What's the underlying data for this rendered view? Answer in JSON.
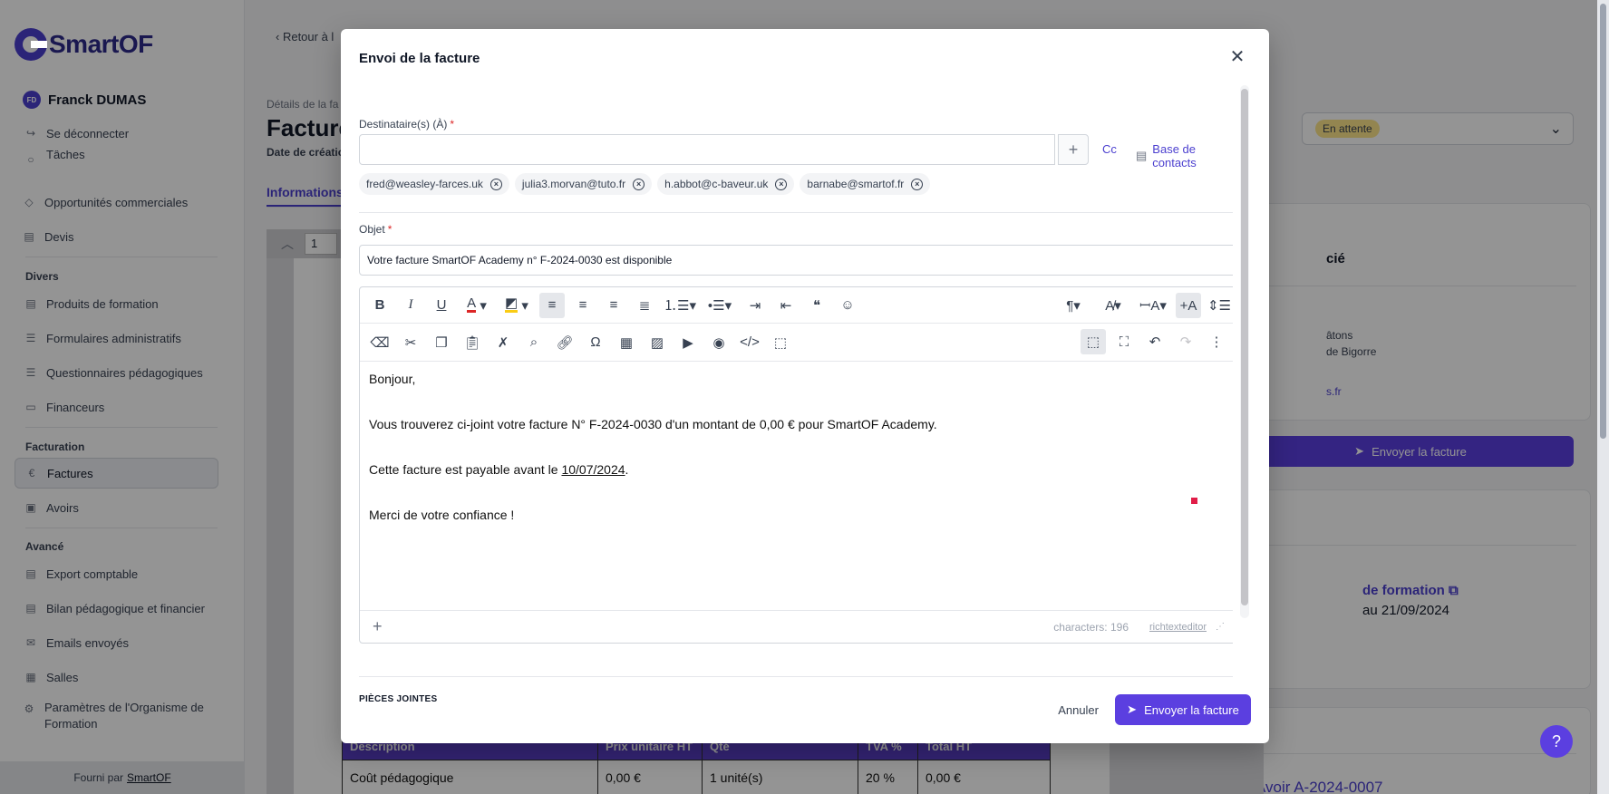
{
  "app": {
    "logo_text": "SmartOF",
    "user_initials": "FD",
    "user_name": "Franck DUMAS",
    "logout": "Se déconnecter",
    "footer_prefix": "Fourni par",
    "footer_link": "SmartOF"
  },
  "sidebar": {
    "items_top": [
      {
        "label": "Tâches"
      },
      {
        "label": "Opportunités commerciales"
      },
      {
        "label": "Devis"
      }
    ],
    "section_divers": "Divers",
    "items_divers": [
      {
        "label": "Produits de formation"
      },
      {
        "label": "Formulaires administratifs"
      },
      {
        "label": "Questionnaires pédagogiques"
      },
      {
        "label": "Financeurs"
      }
    ],
    "section_facturation": "Facturation",
    "items_facturation": [
      {
        "label": "Factures"
      },
      {
        "label": "Avoirs"
      }
    ],
    "section_avance": "Avancé",
    "items_avance": [
      {
        "label": "Export comptable"
      },
      {
        "label": "Bilan pédagogique et financier"
      },
      {
        "label": "Emails envoyés"
      },
      {
        "label": "Salles"
      },
      {
        "label": "Paramètres de l'Organisme de Formation"
      }
    ]
  },
  "page": {
    "back": "Retour à l",
    "breadcrumb": "Détails de la fa",
    "title": "Facture",
    "created": "Date de créatio",
    "tab_info": "Informations",
    "status": "En attente",
    "right_send": "Envoyer la facture",
    "right_text_1": "cié",
    "right_text_2": "âtons",
    "right_text_3": "de Bigorre",
    "right_text_4": "s.fr",
    "right_link_product": "de formation",
    "right_dates": "au 21/09/2024",
    "right_avoir": "Avoir A-2024-0007",
    "pdf_page_input": "1",
    "invoice_table": {
      "headers": [
        "Description",
        "Prix unitaire HT",
        "Qté",
        "TVA %",
        "Total HT"
      ],
      "row": [
        "Coût pédagogique",
        "0,00 €",
        "1 unité(s)",
        "20 %",
        "0,00 €"
      ]
    }
  },
  "modal": {
    "title": "Envoi de la facture",
    "to_label": "Destinataire(s) (À)",
    "to_value": "",
    "cc": "Cc",
    "contacts": "Base de contacts",
    "recipients": [
      "fred@weasley-farces.uk",
      "julia3.morvan@tuto.fr",
      "h.abbot@c-baveur.uk",
      "barnabe@smartof.fr"
    ],
    "subject_label": "Objet",
    "subject_value": "Votre facture SmartOF Academy n° F-2024-0030 est disponible",
    "body": {
      "greeting": "Bonjour,",
      "line1": "Vous trouverez ci-joint votre facture N° F-2024-0030 d'un montant de 0,00 € pour SmartOF Academy.",
      "line2_prefix": "Cette facture est payable avant le ",
      "line2_date": "10/07/2024",
      "line2_suffix": ".",
      "closing": "Merci de votre confiance !"
    },
    "char_count": "characters: 196",
    "rte_brand": "richtexteditor",
    "attachments_title": "PIÈCES JOINTES",
    "cancel": "Annuler",
    "send": "Envoyer la facture"
  },
  "colors": {
    "accent": "#5b3fe0",
    "brand_dark": "#2d2a8a",
    "status_badge": "#fde68a"
  }
}
